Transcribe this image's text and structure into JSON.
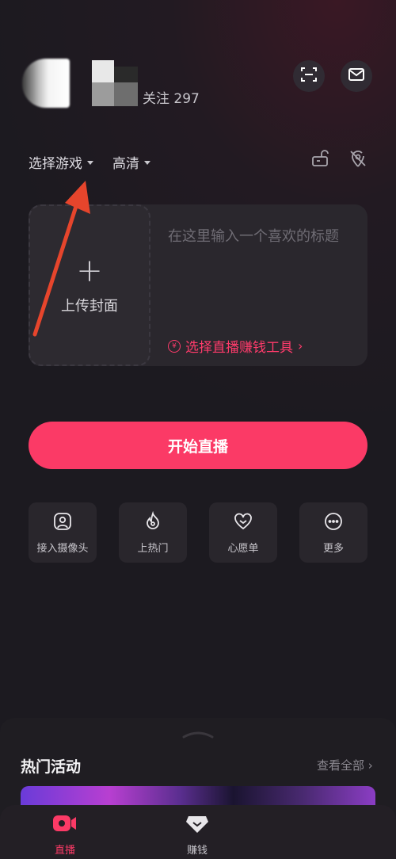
{
  "header": {
    "follow_text": "关注 297",
    "scan_icon": "scan-icon",
    "mail_icon": "mail-icon"
  },
  "selectors": {
    "game_label": "选择游戏",
    "quality_label": "高清",
    "lock_icon": "lock-icon",
    "location_off_icon": "location-off-icon"
  },
  "card": {
    "upload_cover_label": "上传封面",
    "title_placeholder": "在这里输入一个喜欢的标题",
    "earn_tool_label": "选择直播赚钱工具"
  },
  "start_button_label": "开始直播",
  "tools": [
    {
      "label": "接入摄像头",
      "icon": "camera-person-icon"
    },
    {
      "label": "上热门",
      "icon": "fire-icon"
    },
    {
      "label": "心愿单",
      "icon": "heart-icon"
    },
    {
      "label": "更多",
      "icon": "more-icon"
    }
  ],
  "hot_events": {
    "title": "热门活动",
    "see_all": "查看全部"
  },
  "tabbar": {
    "items": [
      {
        "label": "直播",
        "icon": "live-camera-icon",
        "active": true
      },
      {
        "label": "赚钱",
        "icon": "diamond-icon",
        "active": false
      }
    ]
  },
  "colors": {
    "accent": "#fb3a66",
    "link": "#ff3b6b",
    "background": "#1c1a20",
    "annotation_arrow": "#e6452c"
  }
}
